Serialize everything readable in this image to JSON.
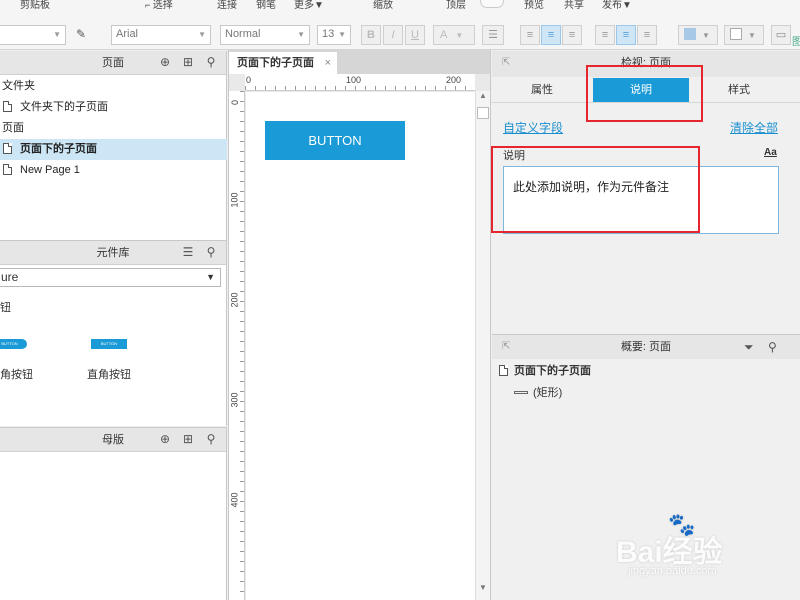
{
  "toolbar": {
    "clipboard_label": "剪贴板",
    "select_label": "选择",
    "connect_label": "连接",
    "pen_label": "钢笔",
    "more_label": "更多▼",
    "zoom_label": "缩放",
    "top_label": "顶层",
    "preview_label": "预览",
    "share_label": "共享",
    "publish_label": "发布▼",
    "font_family": "Arial",
    "font_style": "Normal",
    "font_size": "13",
    "bold": "B",
    "italic": "I",
    "underline": "U",
    "font_color_icon": "A",
    "left_edge_select": ""
  },
  "pages_panel": {
    "title": "页面",
    "items": [
      {
        "label": "文件夹",
        "type": "folder"
      },
      {
        "label": "文件夹下的子页面",
        "type": "page"
      },
      {
        "label": "页面",
        "type": "page"
      },
      {
        "label": "页面下的子页面",
        "type": "page",
        "selected": true
      },
      {
        "label": "New Page 1",
        "type": "page"
      }
    ]
  },
  "library_panel": {
    "title": "元件库",
    "selected_library": "ure",
    "group_label": "钮",
    "widgets": [
      {
        "label": "角按钮",
        "thumb_text": "BUTTON"
      },
      {
        "label": "直角按钮",
        "thumb_text": "BUTTON"
      }
    ]
  },
  "masters_panel": {
    "title": "母版"
  },
  "canvas": {
    "tab_label": "页面下的子页面",
    "close_icon": "×",
    "ruler_h": [
      "0",
      "100",
      "200"
    ],
    "ruler_v": [
      "0",
      "100",
      "200",
      "300",
      "400"
    ],
    "button_text": "BUTTON"
  },
  "inspector": {
    "title": "检视: 页面",
    "tabs": [
      "属性",
      "说明",
      "样式"
    ],
    "active_tab": 1,
    "custom_fields_link": "自定义字段",
    "clear_all_link": "清除全部",
    "notes_label": "说明",
    "font_icon_text": "Aa",
    "notes_text": "此处添加说明，作为元件备注"
  },
  "outline": {
    "title": "概要: 页面",
    "page_name": "页面下的子页面",
    "child_label": "(矩形)"
  },
  "watermark": {
    "brand": "Bai经验",
    "url": "jingyan.baidu.com"
  },
  "colors": {
    "accent": "#1a9ad6",
    "highlight_red": "#e6262f",
    "selected_row": "#cce6f5"
  }
}
